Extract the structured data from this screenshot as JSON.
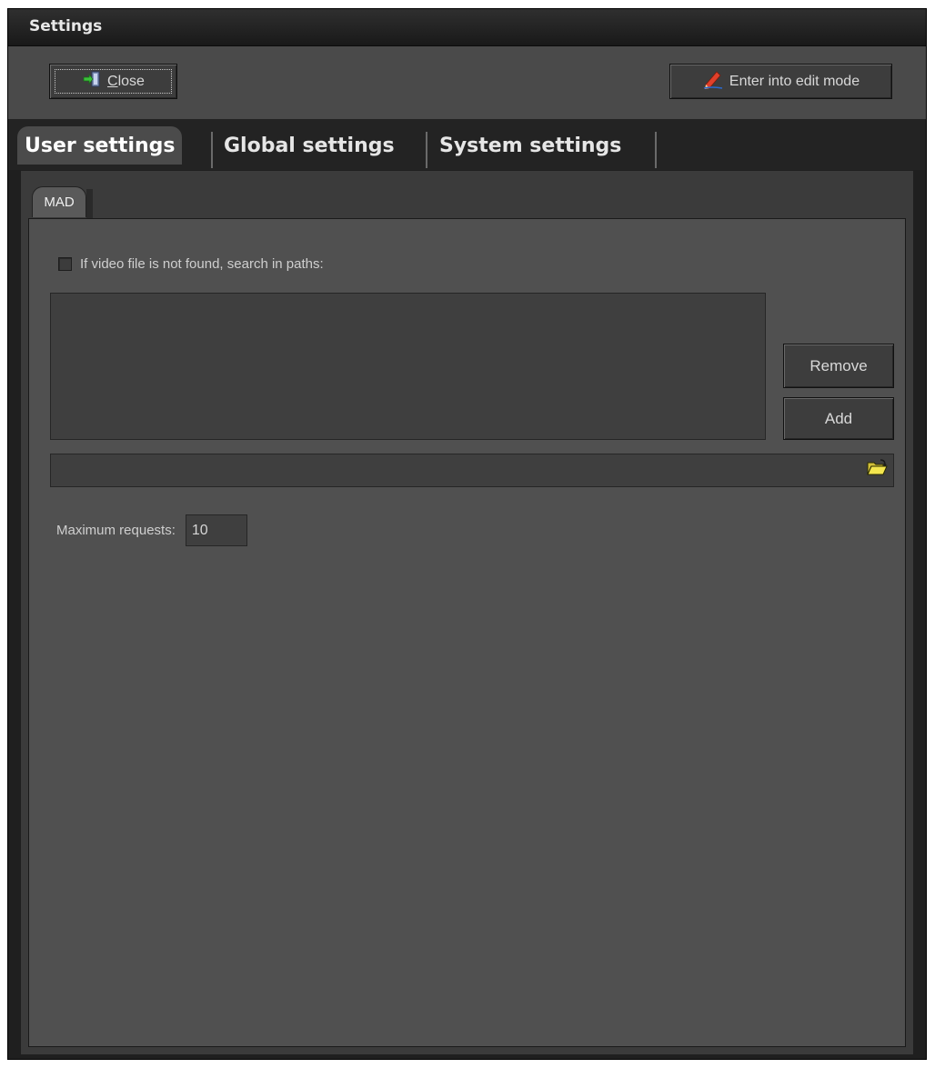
{
  "window": {
    "title": "Settings"
  },
  "toolbar": {
    "close_button": {
      "label_prefix": "",
      "label_mnemonic": "C",
      "label_rest": "lose",
      "icon": "exit-door-icon"
    },
    "edit_button": {
      "label": "Enter into edit mode",
      "icon": "pencil-icon"
    }
  },
  "tabs": [
    {
      "label": "User settings",
      "active": true
    },
    {
      "label": "Global settings",
      "active": false
    },
    {
      "label": "System settings",
      "active": false
    }
  ],
  "subtabs": [
    {
      "label": "MAD",
      "active": true
    }
  ],
  "mad": {
    "search_paths_checkbox": {
      "label": "If video file is not found, search in paths:",
      "checked": false
    },
    "paths_list": [],
    "remove_label": "Remove",
    "add_label": "Add",
    "path_input_value": "",
    "browse_icon": "open-folder-icon",
    "max_requests_label": "Maximum requests:",
    "max_requests_value": "10"
  },
  "colors": {
    "window_bg": "#505050",
    "titlebar_bg": "#232323",
    "text": "#cfcfcf"
  }
}
